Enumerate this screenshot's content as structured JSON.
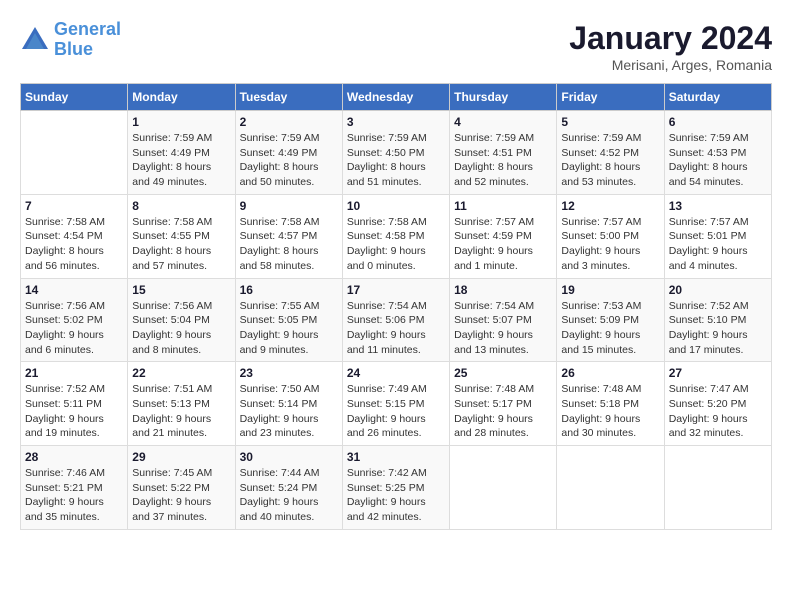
{
  "header": {
    "logo_line1": "General",
    "logo_line2": "Blue",
    "month": "January 2024",
    "location": "Merisani, Arges, Romania"
  },
  "weekdays": [
    "Sunday",
    "Monday",
    "Tuesday",
    "Wednesday",
    "Thursday",
    "Friday",
    "Saturday"
  ],
  "weeks": [
    [
      {
        "day": "",
        "info": ""
      },
      {
        "day": "1",
        "info": "Sunrise: 7:59 AM\nSunset: 4:49 PM\nDaylight: 8 hours\nand 49 minutes."
      },
      {
        "day": "2",
        "info": "Sunrise: 7:59 AM\nSunset: 4:49 PM\nDaylight: 8 hours\nand 50 minutes."
      },
      {
        "day": "3",
        "info": "Sunrise: 7:59 AM\nSunset: 4:50 PM\nDaylight: 8 hours\nand 51 minutes."
      },
      {
        "day": "4",
        "info": "Sunrise: 7:59 AM\nSunset: 4:51 PM\nDaylight: 8 hours\nand 52 minutes."
      },
      {
        "day": "5",
        "info": "Sunrise: 7:59 AM\nSunset: 4:52 PM\nDaylight: 8 hours\nand 53 minutes."
      },
      {
        "day": "6",
        "info": "Sunrise: 7:59 AM\nSunset: 4:53 PM\nDaylight: 8 hours\nand 54 minutes."
      }
    ],
    [
      {
        "day": "7",
        "info": "Sunrise: 7:58 AM\nSunset: 4:54 PM\nDaylight: 8 hours\nand 56 minutes."
      },
      {
        "day": "8",
        "info": "Sunrise: 7:58 AM\nSunset: 4:55 PM\nDaylight: 8 hours\nand 57 minutes."
      },
      {
        "day": "9",
        "info": "Sunrise: 7:58 AM\nSunset: 4:57 PM\nDaylight: 8 hours\nand 58 minutes."
      },
      {
        "day": "10",
        "info": "Sunrise: 7:58 AM\nSunset: 4:58 PM\nDaylight: 9 hours\nand 0 minutes."
      },
      {
        "day": "11",
        "info": "Sunrise: 7:57 AM\nSunset: 4:59 PM\nDaylight: 9 hours\nand 1 minute."
      },
      {
        "day": "12",
        "info": "Sunrise: 7:57 AM\nSunset: 5:00 PM\nDaylight: 9 hours\nand 3 minutes."
      },
      {
        "day": "13",
        "info": "Sunrise: 7:57 AM\nSunset: 5:01 PM\nDaylight: 9 hours\nand 4 minutes."
      }
    ],
    [
      {
        "day": "14",
        "info": "Sunrise: 7:56 AM\nSunset: 5:02 PM\nDaylight: 9 hours\nand 6 minutes."
      },
      {
        "day": "15",
        "info": "Sunrise: 7:56 AM\nSunset: 5:04 PM\nDaylight: 9 hours\nand 8 minutes."
      },
      {
        "day": "16",
        "info": "Sunrise: 7:55 AM\nSunset: 5:05 PM\nDaylight: 9 hours\nand 9 minutes."
      },
      {
        "day": "17",
        "info": "Sunrise: 7:54 AM\nSunset: 5:06 PM\nDaylight: 9 hours\nand 11 minutes."
      },
      {
        "day": "18",
        "info": "Sunrise: 7:54 AM\nSunset: 5:07 PM\nDaylight: 9 hours\nand 13 minutes."
      },
      {
        "day": "19",
        "info": "Sunrise: 7:53 AM\nSunset: 5:09 PM\nDaylight: 9 hours\nand 15 minutes."
      },
      {
        "day": "20",
        "info": "Sunrise: 7:52 AM\nSunset: 5:10 PM\nDaylight: 9 hours\nand 17 minutes."
      }
    ],
    [
      {
        "day": "21",
        "info": "Sunrise: 7:52 AM\nSunset: 5:11 PM\nDaylight: 9 hours\nand 19 minutes."
      },
      {
        "day": "22",
        "info": "Sunrise: 7:51 AM\nSunset: 5:13 PM\nDaylight: 9 hours\nand 21 minutes."
      },
      {
        "day": "23",
        "info": "Sunrise: 7:50 AM\nSunset: 5:14 PM\nDaylight: 9 hours\nand 23 minutes."
      },
      {
        "day": "24",
        "info": "Sunrise: 7:49 AM\nSunset: 5:15 PM\nDaylight: 9 hours\nand 26 minutes."
      },
      {
        "day": "25",
        "info": "Sunrise: 7:48 AM\nSunset: 5:17 PM\nDaylight: 9 hours\nand 28 minutes."
      },
      {
        "day": "26",
        "info": "Sunrise: 7:48 AM\nSunset: 5:18 PM\nDaylight: 9 hours\nand 30 minutes."
      },
      {
        "day": "27",
        "info": "Sunrise: 7:47 AM\nSunset: 5:20 PM\nDaylight: 9 hours\nand 32 minutes."
      }
    ],
    [
      {
        "day": "28",
        "info": "Sunrise: 7:46 AM\nSunset: 5:21 PM\nDaylight: 9 hours\nand 35 minutes."
      },
      {
        "day": "29",
        "info": "Sunrise: 7:45 AM\nSunset: 5:22 PM\nDaylight: 9 hours\nand 37 minutes."
      },
      {
        "day": "30",
        "info": "Sunrise: 7:44 AM\nSunset: 5:24 PM\nDaylight: 9 hours\nand 40 minutes."
      },
      {
        "day": "31",
        "info": "Sunrise: 7:42 AM\nSunset: 5:25 PM\nDaylight: 9 hours\nand 42 minutes."
      },
      {
        "day": "",
        "info": ""
      },
      {
        "day": "",
        "info": ""
      },
      {
        "day": "",
        "info": ""
      }
    ]
  ]
}
